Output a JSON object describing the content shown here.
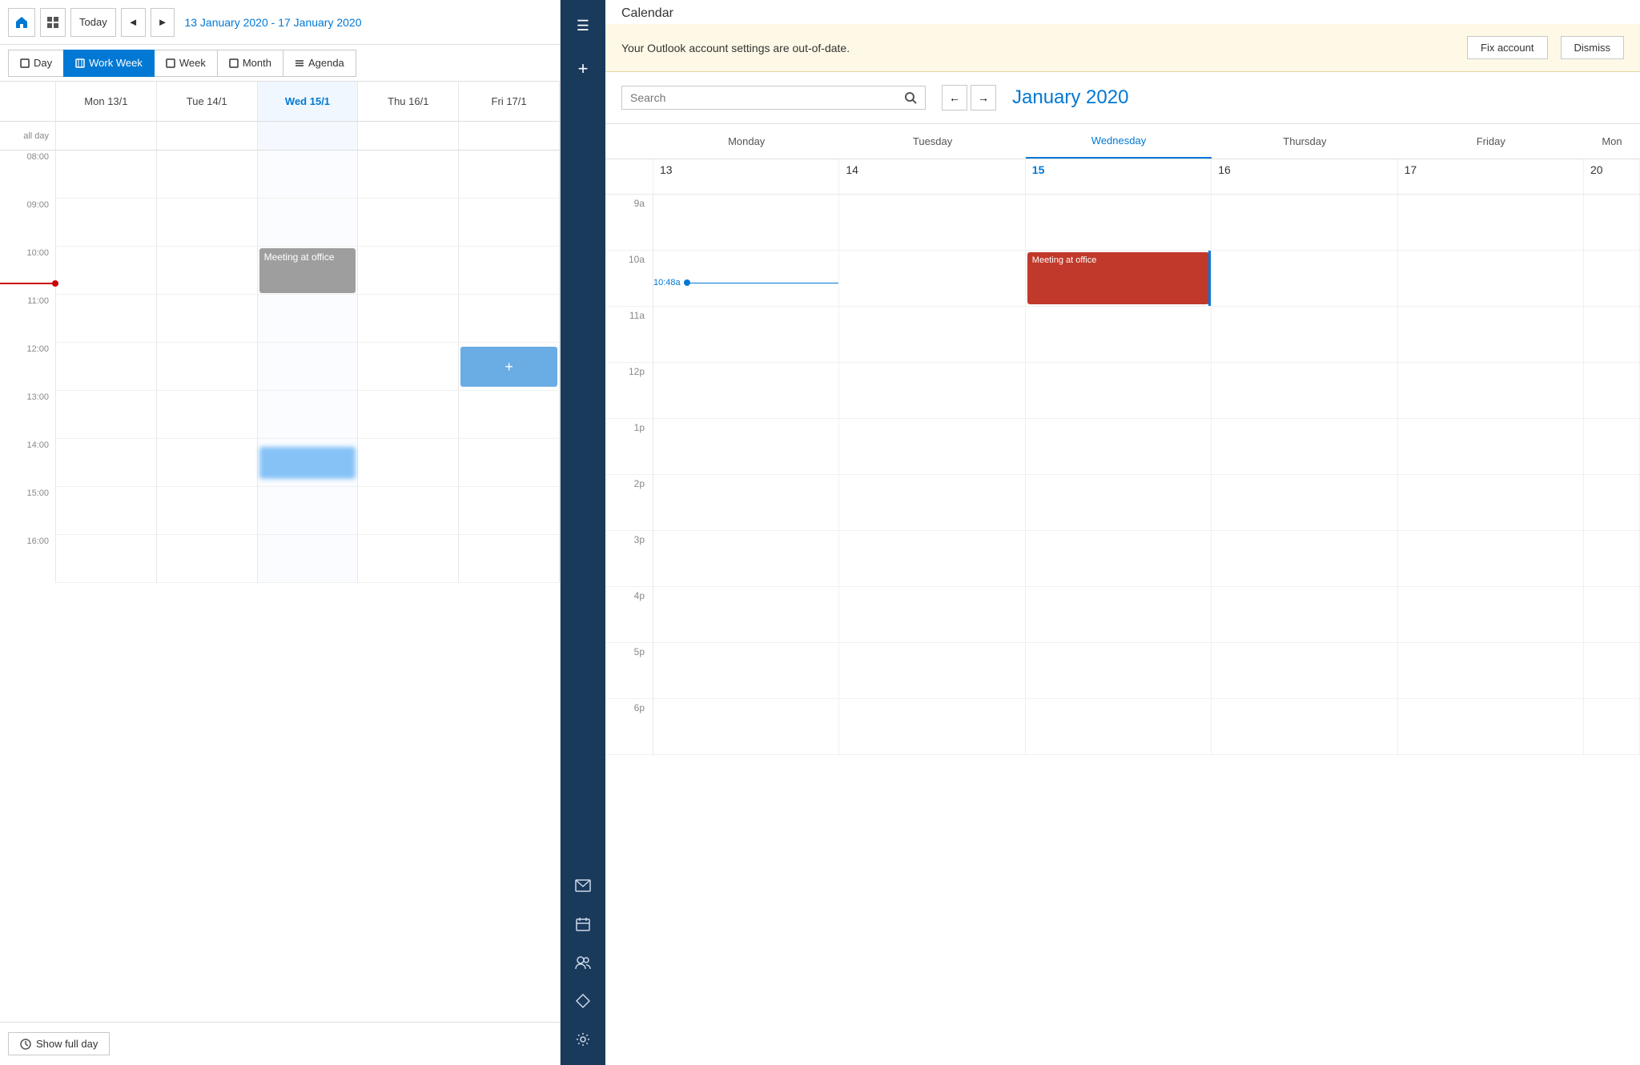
{
  "app": {
    "title": "Calendar"
  },
  "toolbar": {
    "today_label": "Today",
    "date_range": "13 January 2020 - 17 January 2020"
  },
  "view_tabs": {
    "day": "Day",
    "work_week": "Work Week",
    "week": "Week",
    "month": "Month",
    "agenda": "Agenda",
    "active": "work_week"
  },
  "day_headers": {
    "label_col": "all day",
    "days": [
      {
        "label": "Mon 13/1",
        "is_today": false
      },
      {
        "label": "Tue 14/1",
        "is_today": false
      },
      {
        "label": "Wed 15/1",
        "is_today": true
      },
      {
        "label": "Thu 16/1",
        "is_today": false
      },
      {
        "label": "Fri 17/1",
        "is_today": false
      }
    ]
  },
  "time_slots": [
    "08:00",
    "09:00",
    "10:00",
    "11:00",
    "12:00",
    "13:00",
    "14:00",
    "15:00",
    "16:00"
  ],
  "events": {
    "meeting_at_office": {
      "label": "Meeting at office",
      "color": "#9e9e9e"
    },
    "new_event_btn": "+",
    "blurred_event_color": "#6ab4f5"
  },
  "bottom_bar": {
    "show_full_day": "Show full day"
  },
  "notification": {
    "text": "Your Outlook account settings are out-of-date.",
    "fix_label": "Fix account",
    "dismiss_label": "Dismiss"
  },
  "search": {
    "placeholder": "Search",
    "value": ""
  },
  "mini_calendar": {
    "month_title": "January 2020",
    "back_arrow": "←",
    "forward_arrow": "→",
    "day_headers": [
      "Monday",
      "Tuesday",
      "Wednesday",
      "Thursday",
      "Friday",
      "Mon"
    ],
    "dates": [
      13,
      14,
      15,
      16,
      17,
      20
    ],
    "today_date": 15,
    "current_time": "10:48a",
    "time_slots": [
      "9a",
      "10a",
      "11a",
      "12p",
      "1p",
      "2p",
      "3p",
      "4p",
      "5p",
      "6p"
    ],
    "meeting_event": {
      "label": "Meeting at office",
      "color": "#c0392b"
    }
  },
  "sidebar_nav": {
    "hamburger": "☰",
    "plus": "+",
    "mail_icon": "✉",
    "calendar_icon": "▦",
    "people_icon": "👥",
    "tasks_icon": "◇",
    "settings_icon": "⚙"
  }
}
